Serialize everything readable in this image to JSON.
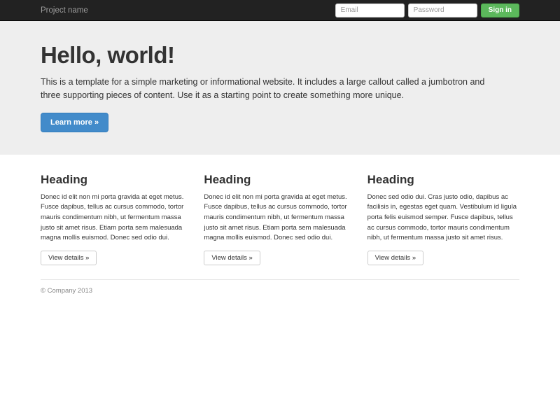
{
  "colors": {
    "navbar_bg": "#222222",
    "jumbotron_bg": "#eeeeee",
    "primary_button": "#428bca",
    "success_button": "#5cb85c",
    "text": "#333333",
    "muted_text": "#999999"
  },
  "navbar": {
    "brand": "Project name",
    "form": {
      "email_placeholder": "Email",
      "password_placeholder": "Password",
      "sign_in_label": "Sign in"
    }
  },
  "jumbotron": {
    "title": "Hello, world!",
    "description": "This is a template for a simple marketing or informational website. It includes a large callout called a jumbotron and three supporting pieces of content. Use it as a starting point to create something more unique.",
    "cta_label": "Learn more »"
  },
  "content": {
    "columns": [
      {
        "heading": "Heading",
        "text": "Donec id elit non mi porta gravida at eget metus. Fusce dapibus, tellus ac cursus commodo, tortor mauris condimentum nibh, ut fermentum massa justo sit amet risus. Etiam porta sem malesuada magna mollis euismod. Donec sed odio dui.",
        "button_label": "View details »"
      },
      {
        "heading": "Heading",
        "text": "Donec id elit non mi porta gravida at eget metus. Fusce dapibus, tellus ac cursus commodo, tortor mauris condimentum nibh, ut fermentum massa justo sit amet risus. Etiam porta sem malesuada magna mollis euismod. Donec sed odio dui.",
        "button_label": "View details »"
      },
      {
        "heading": "Heading",
        "text": "Donec sed odio dui. Cras justo odio, dapibus ac facilisis in, egestas eget quam. Vestibulum id ligula porta felis euismod semper. Fusce dapibus, tellus ac cursus commodo, tortor mauris condimentum nibh, ut fermentum massa justo sit amet risus.",
        "button_label": "View details »"
      }
    ]
  },
  "footer": {
    "copyright": "© Company 2013"
  }
}
